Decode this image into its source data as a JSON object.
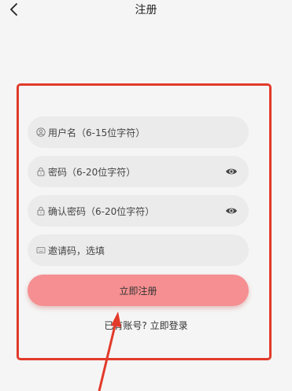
{
  "header": {
    "title": "注册"
  },
  "form": {
    "username_placeholder": "用户名（6-15位字符）",
    "password_placeholder": "密码（6-20位字符）",
    "confirm_placeholder": "确认密码（6-20位字符）",
    "invite_placeholder": "邀请码，选填",
    "submit_label": "立即注册",
    "login_link": "已有账号? 立即登录"
  },
  "icons": {
    "back": "chevron-left-icon",
    "username": "user-circle-icon",
    "password": "lock-icon",
    "confirm": "lock-icon",
    "invite": "abc-keyboard-icon",
    "eye": "eye-icon"
  },
  "colors": {
    "background": "#f5f5f5",
    "field": "#ebebeb",
    "submit": "#f58f91",
    "annotation": "#e23a2a"
  }
}
